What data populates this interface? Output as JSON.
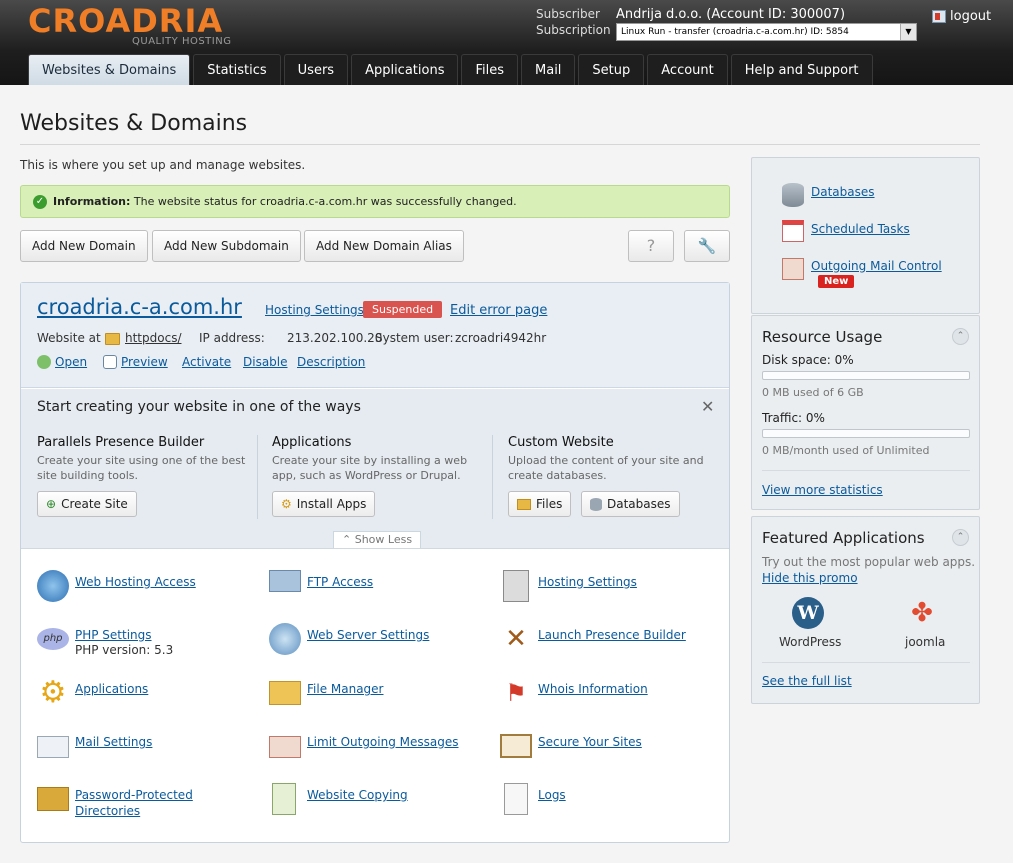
{
  "brand": {
    "logo": "CROADRIA",
    "tagline": "QUALITY HOSTING"
  },
  "header": {
    "subscriber_label": "Subscriber",
    "subscriber_value": "Andrija d.o.o. (Account ID: 300007)",
    "subscription_label": "Subscription",
    "subscription_value": "Linux Run - transfer (croadria.c-a.com.hr) ID: 5854",
    "logout": "logout"
  },
  "tabs": [
    {
      "label": "Websites & Domains"
    },
    {
      "label": "Statistics"
    },
    {
      "label": "Users"
    },
    {
      "label": "Applications"
    },
    {
      "label": "Files"
    },
    {
      "label": "Mail"
    },
    {
      "label": "Setup"
    },
    {
      "label": "Account"
    },
    {
      "label": "Help and Support"
    }
  ],
  "page": {
    "title": "Websites & Domains",
    "intro": "This is where you set up and manage websites.",
    "info_label": "Information:",
    "info_text": "The website status for croadria.c-a.com.hr was successfully changed."
  },
  "actions": {
    "add_domain": "Add New Domain",
    "add_subdomain": "Add New Subdomain",
    "add_alias": "Add New Domain Alias",
    "help": "?"
  },
  "domain": {
    "name": "croadria.c-a.com.hr",
    "hosting_settings": "Hosting Settings",
    "status": "Suspended",
    "edit_error": "Edit error page",
    "website_at": "Website at",
    "docroot": "httpdocs/",
    "ip_label": "IP address:",
    "ip": "213.202.100.20",
    "sysuser_label": "System user:",
    "sysuser": "zcroadri4942hr",
    "ops": [
      "Open",
      "Preview",
      "Activate",
      "Disable",
      "Description"
    ]
  },
  "ways": {
    "heading": "Start creating your website in one of the ways",
    "builder_title": "Parallels Presence Builder",
    "builder_desc": "Create your site using one of the best site building tools.",
    "builder_btn": "Create Site",
    "apps_title": "Applications",
    "apps_desc": "Create your site by installing a web app, such as WordPress or Drupal.",
    "apps_btn": "Install Apps",
    "custom_title": "Custom Website",
    "custom_desc": "Upload the content of your site and create databases.",
    "files_btn": "Files",
    "db_btn": "Databases",
    "show_less": "Show Less"
  },
  "tools": {
    "c1": [
      "Web Hosting Access",
      "PHP Settings",
      "Applications",
      "Mail Settings",
      "Password-Protected Directories"
    ],
    "php_version": "PHP version: 5.3",
    "c2": [
      "FTP Access",
      "Web Server Settings",
      "File Manager",
      "Limit Outgoing Messages",
      "Website Copying"
    ],
    "c3": [
      "Hosting Settings",
      "Launch Presence Builder",
      "Whois Information",
      "Secure Your Sites",
      "Logs"
    ]
  },
  "sidebar": {
    "links": [
      "Databases",
      "Scheduled Tasks",
      "Outgoing Mail Control"
    ],
    "new_badge": "New",
    "resource_title": "Resource Usage",
    "disk": "Disk space: 0%",
    "disk_used": "0 MB used of 6 GB",
    "disk_fill": 0,
    "traffic": "Traffic: 0%",
    "traffic_used": "0 MB/month used of Unlimited",
    "traffic_fill": 0,
    "more_stats": "View more statistics",
    "featured_title": "Featured Applications",
    "featured_desc": "Try out the most popular web apps.",
    "hide_promo": "Hide this promo",
    "apps": [
      "WordPress",
      "joomla"
    ],
    "full_list": "See the full list"
  }
}
